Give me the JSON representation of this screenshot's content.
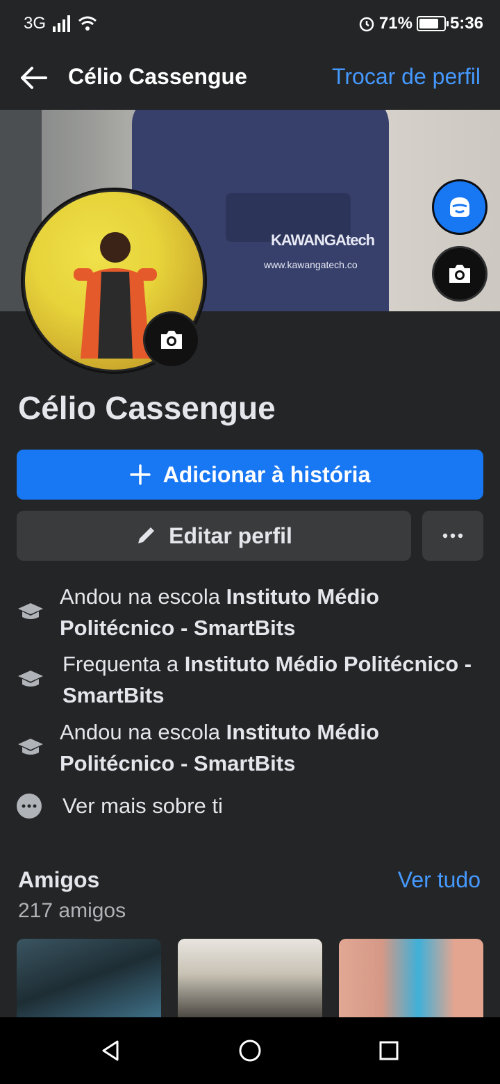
{
  "status_bar": {
    "network": "3G",
    "battery_percent": "71%",
    "battery_level": 0.71,
    "time": "5:36"
  },
  "header": {
    "title": "Célio Cassengue",
    "switch_profile": "Trocar de perfil"
  },
  "cover": {
    "brand_text": "KAWANGAtech",
    "url_text": "www.kawangatech.co"
  },
  "profile": {
    "name": "Célio Cassengue",
    "add_story_label": "Adicionar à história",
    "edit_profile_label": "Editar perfil",
    "more_label": "···"
  },
  "info": [
    {
      "prefix": "Andou na escola ",
      "bold": "Instituto Médio Politécnico - SmartBits"
    },
    {
      "prefix": "Frequenta a ",
      "bold": "Instituto Médio Politécnico - SmartBits"
    },
    {
      "prefix": "Andou na escola ",
      "bold": "Instituto Médio Politécnico - SmartBits"
    }
  ],
  "see_more": "Ver mais sobre ti",
  "friends": {
    "title": "Amigos",
    "see_all": "Ver tudo",
    "count": "217 amigos"
  },
  "colors": {
    "accent": "#1877f2",
    "link": "#4599ff",
    "background": "#242526"
  }
}
